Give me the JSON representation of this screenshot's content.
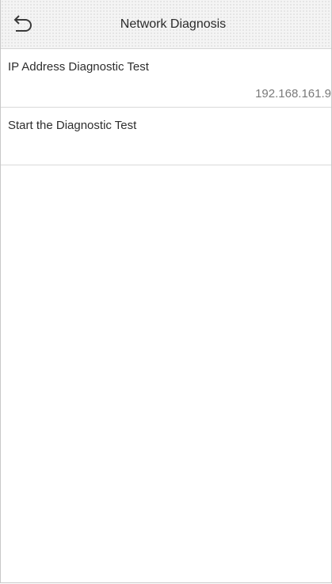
{
  "header": {
    "back_icon": "back-arrow-icon",
    "title": "Network Diagnosis"
  },
  "menu": {
    "items": [
      {
        "label": "IP Address Diagnostic Test",
        "value": "192.168.161.9"
      },
      {
        "label": "Start the Diagnostic Test"
      }
    ]
  },
  "colors": {
    "header_bg": "#f4f4f4",
    "divider": "#d9d9d9",
    "label_text": "#2e2e2e",
    "value_text": "#7a7a7a"
  }
}
